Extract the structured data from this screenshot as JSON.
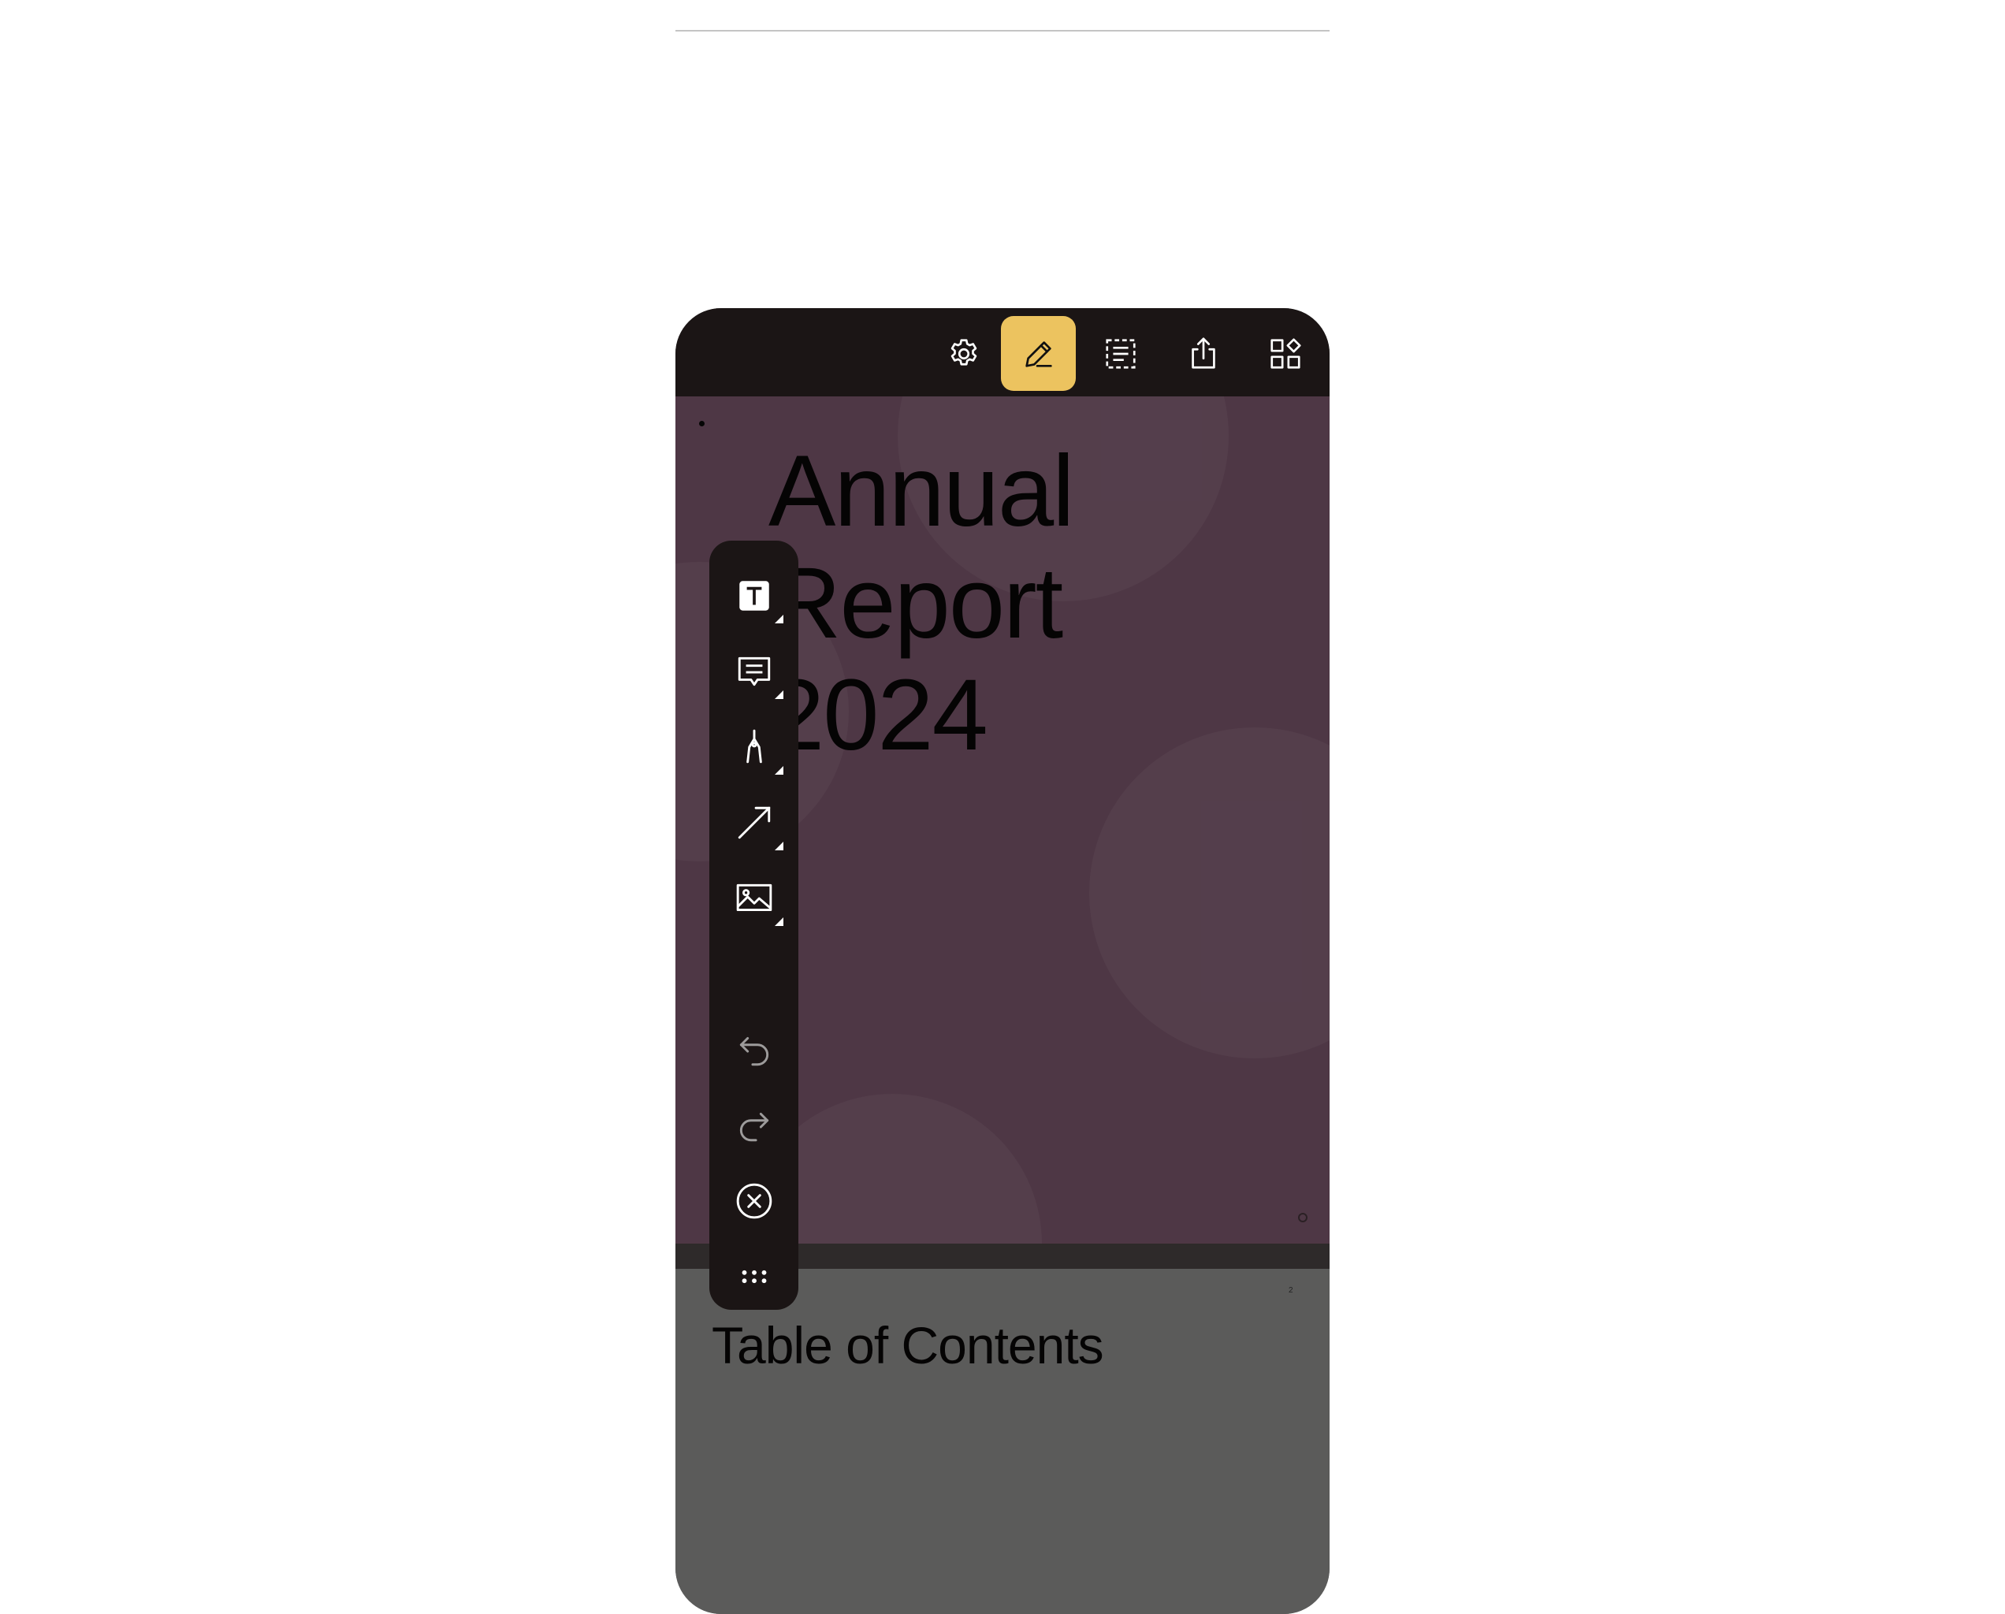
{
  "document": {
    "cover_title": "Annual\nReport\n2024",
    "toc_title": "Table of Contents",
    "page_number": "2"
  },
  "toolbar": {
    "items": [
      {
        "icon": "gear-icon",
        "label": "Settings"
      },
      {
        "icon": "pencil-icon",
        "label": "Annotate",
        "active": true
      },
      {
        "icon": "text-selection-icon",
        "label": "Select Text"
      },
      {
        "icon": "share-icon",
        "label": "Share"
      },
      {
        "icon": "thumbnails-icon",
        "label": "Thumbnails"
      }
    ],
    "active_color": "#ecc35f",
    "background": "#1b1515"
  },
  "annotation_tools": {
    "items": [
      {
        "icon": "text-tool-icon",
        "label": "Text"
      },
      {
        "icon": "comment-icon",
        "label": "Note"
      },
      {
        "icon": "pen-icon",
        "label": "Ink"
      },
      {
        "icon": "arrow-line-icon",
        "label": "Line"
      },
      {
        "icon": "image-icon",
        "label": "Image"
      },
      {
        "icon": "undo-icon",
        "label": "Undo"
      },
      {
        "icon": "redo-icon",
        "label": "Redo"
      },
      {
        "icon": "close-circle-icon",
        "label": "Close"
      },
      {
        "icon": "drag-handle-icon",
        "label": "Move toolbar"
      }
    ]
  },
  "colors": {
    "cover_background": "#4e3745",
    "page_background": "#5b5b5a",
    "text": "#050404"
  }
}
